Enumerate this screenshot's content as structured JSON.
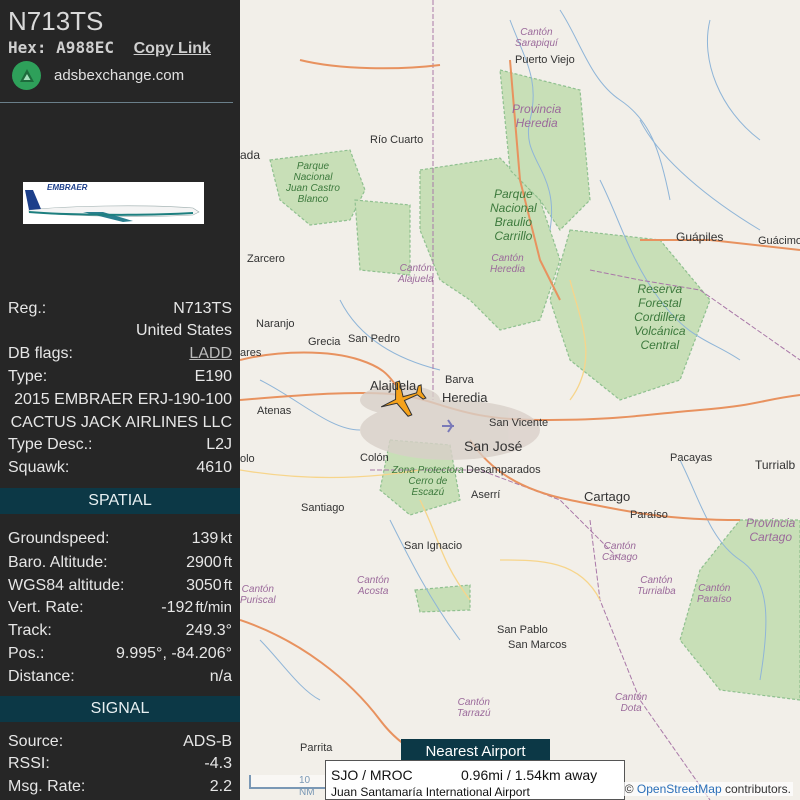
{
  "aircraft": {
    "callsign": "N713TS",
    "hex_label": "Hex:",
    "hex": "A988EC",
    "copy_link": "Copy Link",
    "site": "adsbexchange.com",
    "photo_text": "EMBRAER"
  },
  "details": {
    "reg_label": "Reg.:",
    "reg": "N713TS",
    "country": "United States",
    "dbflags_label": "DB flags:",
    "dbflags": "LADD",
    "type_label": "Type:",
    "type": "E190",
    "model": "2015 EMBRAER ERJ-190-100",
    "operator": "CACTUS JACK AIRLINES LLC",
    "typedesc_label": "Type Desc.:",
    "typedesc": "L2J",
    "squawk_label": "Squawk:",
    "squawk": "4610"
  },
  "spatial": {
    "header": "SPATIAL",
    "groundspeed_label": "Groundspeed:",
    "groundspeed": "139",
    "groundspeed_unit": "kt",
    "baro_label": "Baro. Altitude:",
    "baro": "2900",
    "baro_unit": "ft",
    "wgs_label": "WGS84 altitude:",
    "wgs": "3050",
    "wgs_unit": "ft",
    "vrate_label": "Vert. Rate:",
    "vrate": "-192",
    "vrate_unit": "ft/min",
    "track_label": "Track:",
    "track": "249.3°",
    "pos_label": "Pos.:",
    "pos": "9.995°, -84.206°",
    "distance_label": "Distance:",
    "distance": "n/a"
  },
  "signal": {
    "header": "SIGNAL",
    "source_label": "Source:",
    "source": "ADS-B",
    "rssi_label": "RSSI:",
    "rssi": "-4.3",
    "msgrate_label": "Msg. Rate:",
    "msgrate": "2.2"
  },
  "map": {
    "labels": {
      "sarapiqui": "Cantón\nSarapiquí",
      "puerto_viejo": "Puerto Viejo",
      "provincia_heredia": "Provincia\nHeredia",
      "ada": "ada",
      "rio_cuarto": "Río Cuarto",
      "juan_castro": "Parque\nNacional\nJuan Castro\nBlanco",
      "braulio": "Parque\nNacional\nBraulio\nCarrillo",
      "guapiles": "Guápiles",
      "guacimo": "Guácimo",
      "zarcero": "Zarcero",
      "canton_alajuela": "Cantón\nAlajuela",
      "canton_heredia": "Cantón\nHeredia",
      "reserva": "Reserva\nForestal\nCordillera\nVolcánica\nCentral",
      "naranjo": "Naranjo",
      "grecia": "Grecia",
      "san_pedro": "San Pedro",
      "ares": "ares",
      "alajuela": "Alajuela",
      "barva": "Barva",
      "heredia": "Heredia",
      "atenas": "Atenas",
      "san_vicente": "San Vicente",
      "san_jose": "San José",
      "colon": "Colón",
      "desamparados": "Desamparados",
      "zona_protectora": "Zona Protectora\nCerro de\nEscazú",
      "pacayas": "Pacayas",
      "turrialba": "Turrialb",
      "olo": "olo",
      "aserri": "Aserrí",
      "cartago": "Cartago",
      "paraiso": "Paraíso",
      "santiago": "Santiago",
      "provincia_cartago": "Provincia\nCartago",
      "san_ignacio": "San Ignacio",
      "canton_cartago": "Cantón\nCartago",
      "canton_acosta": "Cantón\nAcosta",
      "canton_turrialba": "Cantón\nTurrialba",
      "canton_puriscal": "Cantón\nPuriscal",
      "canton_paraiso": "Cantón\nParaíso",
      "san_pablo": "San Pablo",
      "san_marcos": "San Marcos",
      "canton_tarrazu": "Cantón\nTarrazú",
      "canton_dota": "Cantón\nDota",
      "parrita": "Parrita"
    },
    "scale": "10 NM",
    "attribution_prefix": "©",
    "attribution_link": "OpenStreetMap",
    "attribution_suffix": "contributors.",
    "colors": {
      "forest": "#c8dfb7",
      "road": "#e8925f",
      "border": "#a978a8",
      "water": "#8fb5d8",
      "plane": "#f5a21b"
    }
  },
  "nearest": {
    "header": "Nearest Airport",
    "codes": "SJO / MROC",
    "distance": "0.96mi / 1.54km away",
    "name": "Juan Santamaría International Airport"
  }
}
